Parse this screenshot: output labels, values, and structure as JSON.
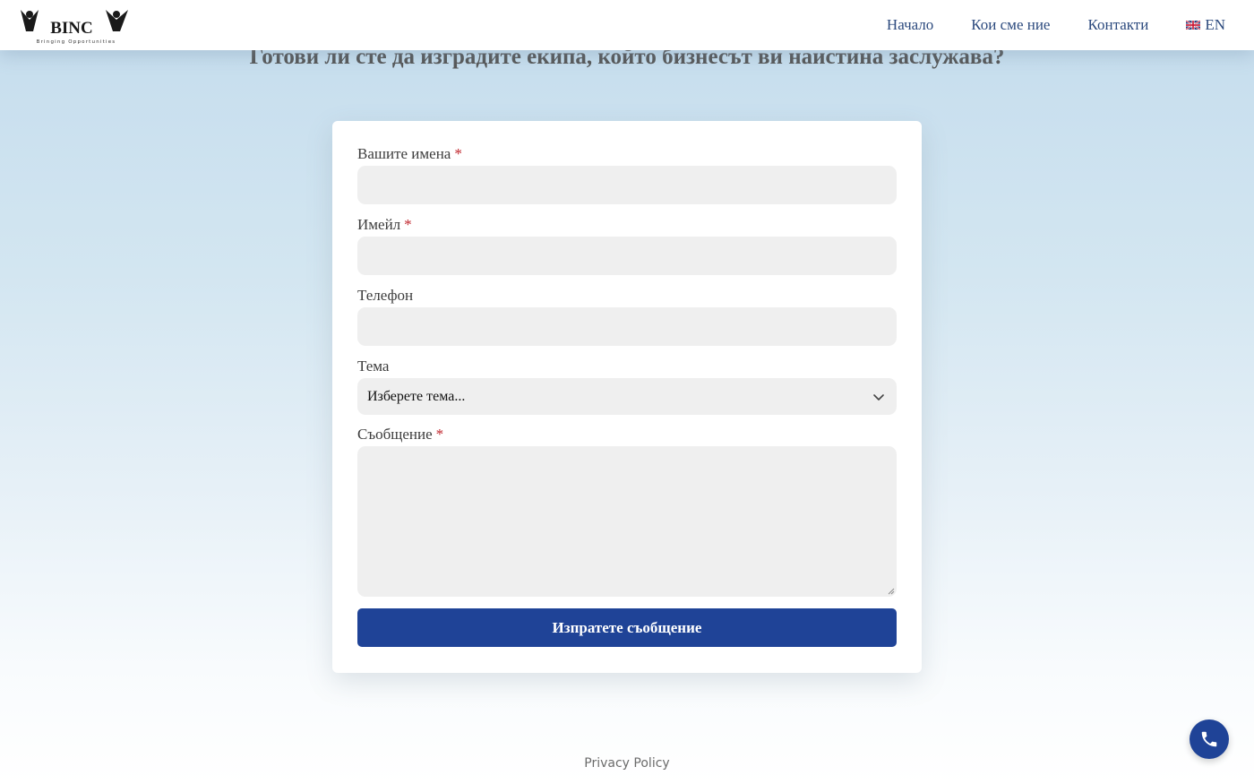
{
  "header": {
    "logo": {
      "brand": "BINC",
      "tagline": "Bringing Opportunities"
    },
    "nav": [
      {
        "label": "Начало"
      },
      {
        "label": "Кои сме ние"
      },
      {
        "label": "Контакти"
      },
      {
        "label": "EN",
        "icon": "uk-flag-icon"
      }
    ]
  },
  "title": "Готови ли сте да изградите екипа, който бизнесът ви наистина заслужава?",
  "form": {
    "name_label": "Вашите имена",
    "email_label": "Имейл",
    "phone_label": "Телефон",
    "topic_label": "Тема",
    "topic_value": "Изберете тема...",
    "message_label": "Съобщение",
    "required_mark": "*",
    "submit_label": "Изпратете съобщение"
  },
  "footer": {
    "privacy_link": "Privacy Policy"
  },
  "colors": {
    "brand": "#1f4397",
    "nav_text": "#2c4a7e",
    "required": "#c0262d"
  },
  "icons": {
    "call": "phone-icon",
    "select": "chevron-down-icon"
  }
}
